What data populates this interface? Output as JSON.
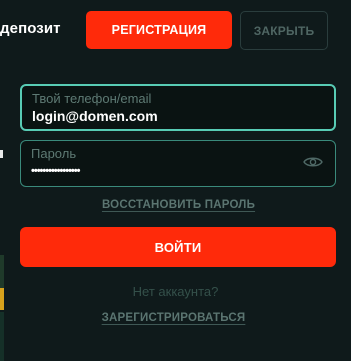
{
  "header": {
    "deposit_text": "депозит",
    "register_label": "РЕГИСТРАЦИЯ",
    "close_label": "ЗАКРЫТЬ"
  },
  "form": {
    "login": {
      "label": "Твой телефон/email",
      "value": "login@domen.com"
    },
    "password": {
      "label": "Пароль",
      "value": "•••••••••••••••••"
    },
    "restore_link": "ВОССТАНОВИТЬ ПАРОЛЬ",
    "submit_label": "ВОЙТИ",
    "no_account_text": "Нет аккаунта?",
    "signup_link": "ЗАРЕГИСТРИРОВАТЬСЯ"
  },
  "icons": {
    "password_toggle": "eye-icon"
  },
  "colors": {
    "accent": "#ff2a0a",
    "field_border": "#58ccb5",
    "background": "#0f1a1b"
  }
}
